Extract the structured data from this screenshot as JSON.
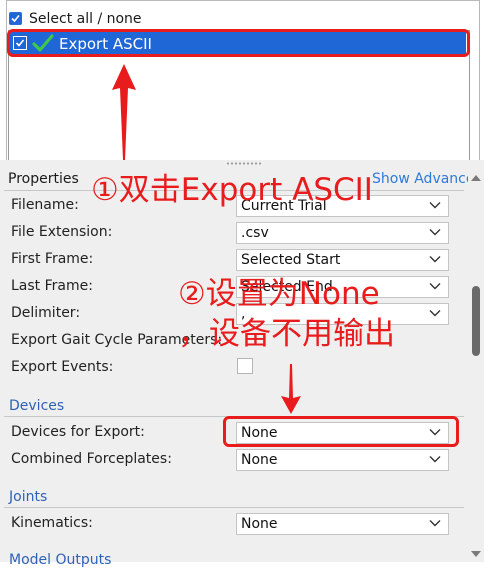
{
  "list": {
    "select_all_label": "Select all / none",
    "items": [
      {
        "label": "Export ASCII",
        "checked": true,
        "selected": true
      }
    ]
  },
  "properties": {
    "title": "Properties",
    "show_advanced_label": "Show Advanced",
    "rows": [
      {
        "label": "Filename:",
        "value": "Current Trial"
      },
      {
        "label": "File Extension:",
        "value": ".csv"
      },
      {
        "label": "First Frame:",
        "value": "Selected Start"
      },
      {
        "label": "Last Frame:",
        "value": "Selected End"
      },
      {
        "label": "Delimiter:",
        "value": ","
      },
      {
        "label": "Export Gait Cycle Parameters:",
        "value": ""
      },
      {
        "label": "Export Events:",
        "value": ""
      }
    ],
    "devices": {
      "section_label": "Devices",
      "rows": [
        {
          "label": "Devices for Export:",
          "value": "None"
        },
        {
          "label": "Combined Forceplates:",
          "value": "None"
        }
      ]
    },
    "joints": {
      "section_label": "Joints",
      "rows": [
        {
          "label": "Kinematics:",
          "value": "None"
        }
      ]
    },
    "model_outputs": {
      "section_label": "Model Outputs"
    }
  },
  "annotations": {
    "step1": "①双击Export ASCII",
    "step2": "②设置为None",
    "step2_detail": "，设备不用输出"
  },
  "colors": {
    "accent_blue": "#1f66d6",
    "section_blue": "#2e62b5",
    "annotation_red": "#e81c1c",
    "check_green": "#3ec84a"
  }
}
